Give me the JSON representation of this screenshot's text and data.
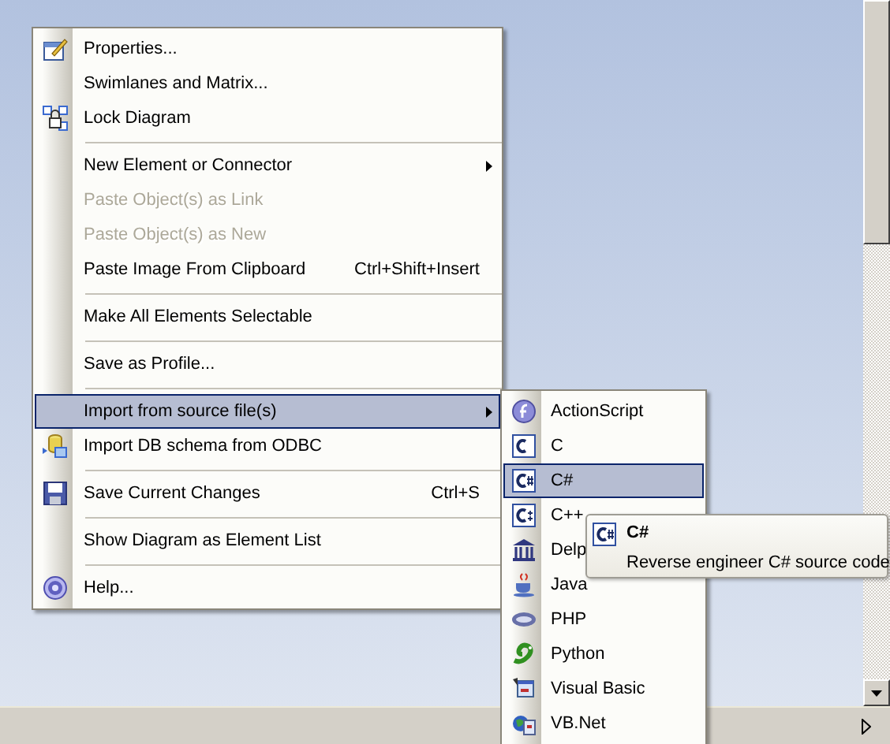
{
  "main_menu": {
    "items": [
      {
        "kind": "item",
        "label": "Properties...",
        "selected": false,
        "disabled": false,
        "has_submenu": false
      },
      {
        "kind": "item",
        "label": "Swimlanes and Matrix...",
        "selected": false,
        "disabled": false,
        "has_submenu": false
      },
      {
        "kind": "item",
        "label": "Lock Diagram",
        "selected": false,
        "disabled": false,
        "has_submenu": false
      },
      {
        "kind": "separator"
      },
      {
        "kind": "item",
        "label": "New Element or Connector",
        "selected": false,
        "disabled": false,
        "has_submenu": true
      },
      {
        "kind": "item",
        "label": "Paste Object(s) as Link",
        "selected": false,
        "disabled": true,
        "has_submenu": false
      },
      {
        "kind": "item",
        "label": "Paste Object(s) as New",
        "selected": false,
        "disabled": true,
        "has_submenu": false
      },
      {
        "kind": "item",
        "label": "Paste Image From Clipboard",
        "shortcut": "Ctrl+Shift+Insert",
        "selected": false,
        "disabled": false,
        "has_submenu": false
      },
      {
        "kind": "separator"
      },
      {
        "kind": "item",
        "label": "Make All Elements Selectable",
        "selected": false,
        "disabled": false,
        "has_submenu": false
      },
      {
        "kind": "separator"
      },
      {
        "kind": "item",
        "label": "Save as Profile...",
        "selected": false,
        "disabled": false,
        "has_submenu": false
      },
      {
        "kind": "separator"
      },
      {
        "kind": "item",
        "label": "Import from source file(s)",
        "selected": true,
        "disabled": false,
        "has_submenu": true
      },
      {
        "kind": "item",
        "label": "Import DB schema from ODBC",
        "selected": false,
        "disabled": false,
        "has_submenu": false
      },
      {
        "kind": "separator"
      },
      {
        "kind": "item",
        "label": "Save Current Changes",
        "shortcut": "Ctrl+S",
        "selected": false,
        "disabled": false,
        "has_submenu": false
      },
      {
        "kind": "separator"
      },
      {
        "kind": "item",
        "label": "Show Diagram as Element List",
        "selected": false,
        "disabled": false,
        "has_submenu": false
      },
      {
        "kind": "separator"
      },
      {
        "kind": "item",
        "label": "Help...",
        "selected": false,
        "disabled": false,
        "has_submenu": false
      }
    ]
  },
  "submenu": {
    "items": [
      {
        "label": "ActionScript",
        "selected": false
      },
      {
        "label": "C",
        "selected": false
      },
      {
        "label": "C#",
        "selected": true
      },
      {
        "label": "C++",
        "selected": false
      },
      {
        "label": "Delp",
        "selected": false
      },
      {
        "label": "Java",
        "selected": false
      },
      {
        "label": "PHP",
        "selected": false
      },
      {
        "label": "Python",
        "selected": false
      },
      {
        "label": "Visual Basic",
        "selected": false
      },
      {
        "label": "VB.Net",
        "selected": false
      }
    ]
  },
  "tooltip": {
    "title": "C#",
    "description": "Reverse engineer C# source code"
  }
}
